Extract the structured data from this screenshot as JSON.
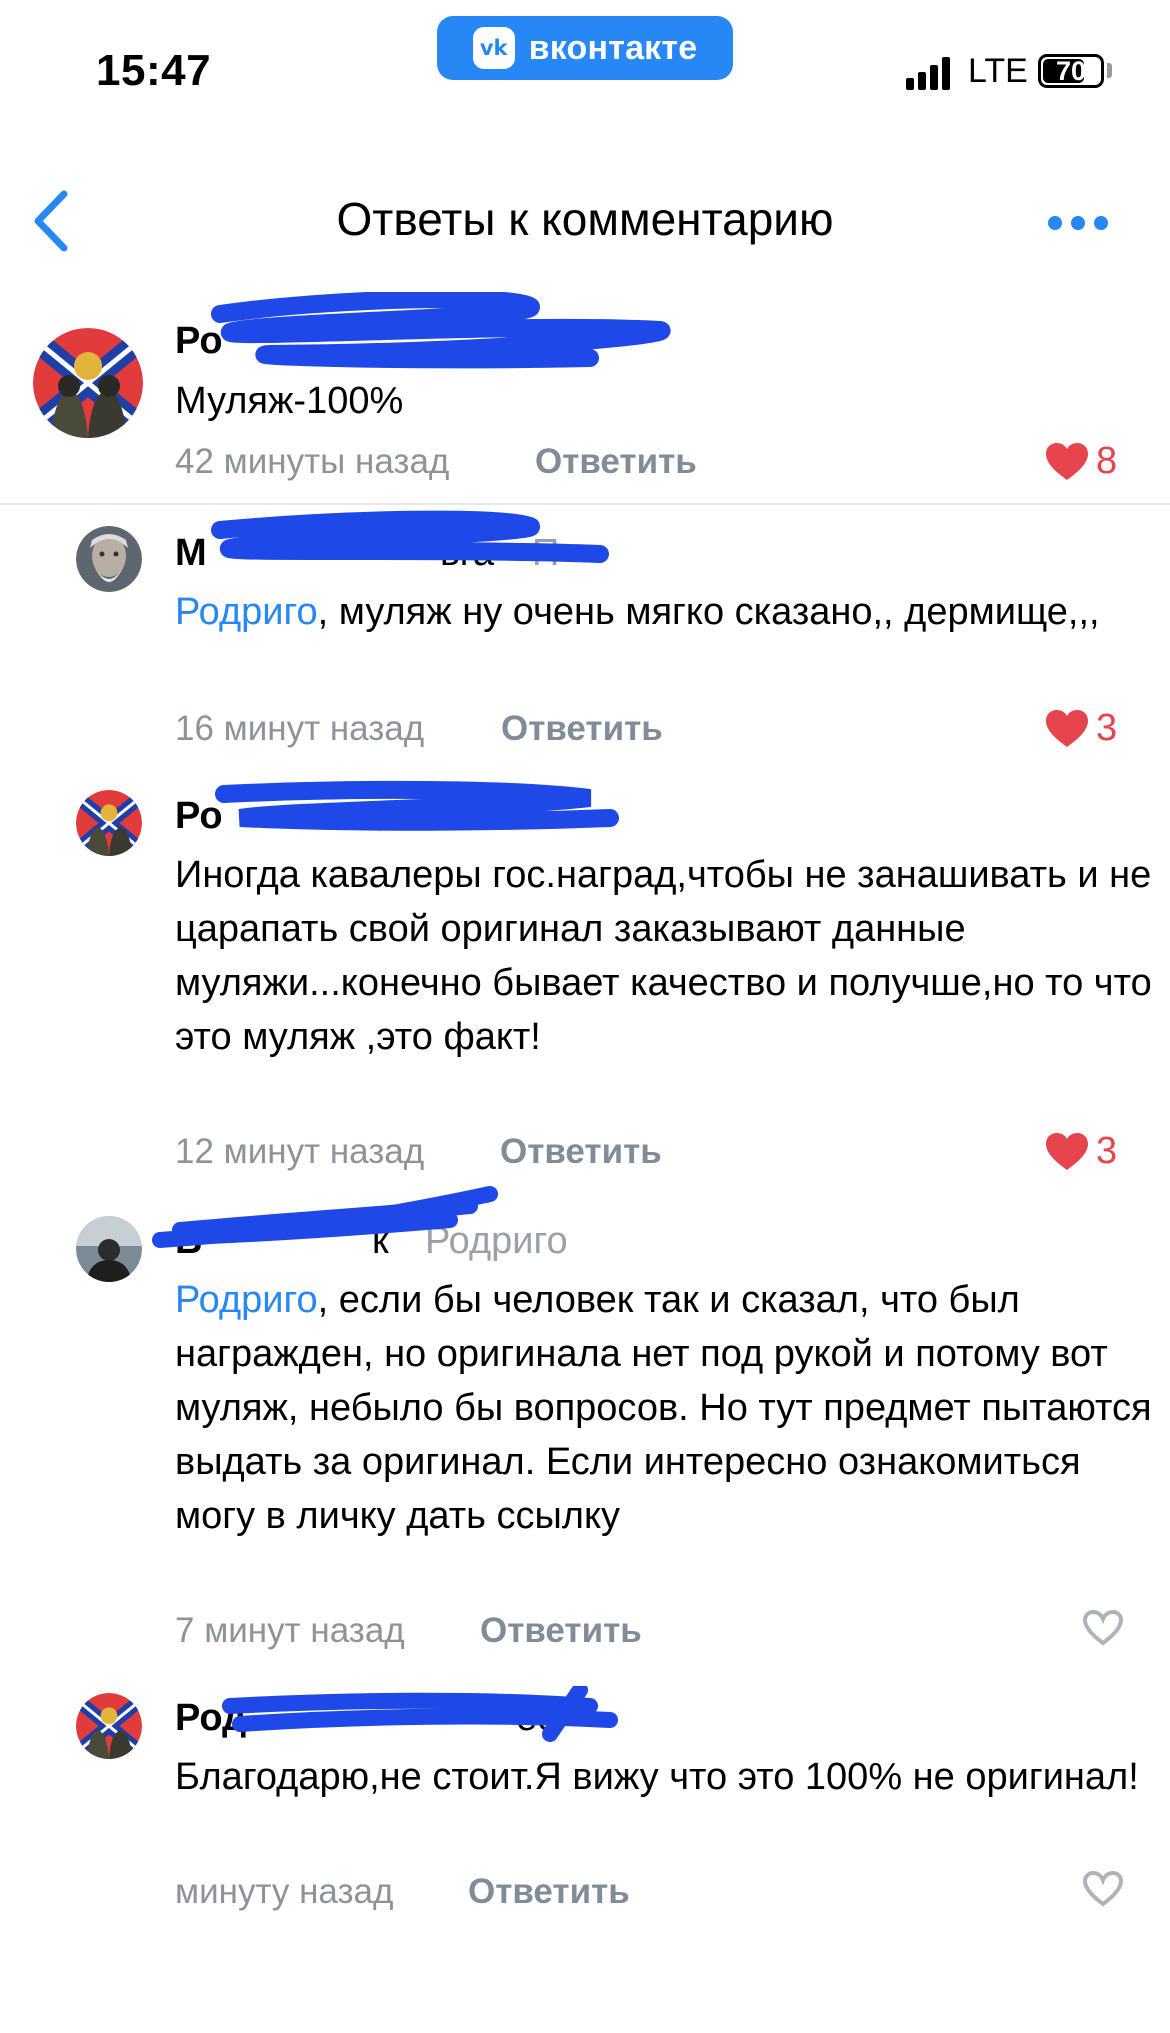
{
  "status_bar": {
    "time": "15:47",
    "network": "LTE",
    "battery": "70"
  },
  "vk_badge": {
    "logo_text": "vk",
    "label": "вконтакте"
  },
  "header": {
    "title": "Ответы к комментарию"
  },
  "comments": [
    {
      "name": "Ро",
      "text": "Муляж-100%",
      "time": "42 минуты назад",
      "reply": "Ответить",
      "likes": "8",
      "liked": true
    },
    {
      "name": "М",
      "name_suffix": "ьга",
      "name_tail": "П",
      "mention": "Родриго",
      "text": ", муляж ну очень мягко сказано,, дермище,,,",
      "time": "16 минут назад",
      "reply": "Ответить",
      "likes": "3",
      "liked": true
    },
    {
      "name": "Ро",
      "text": "Иногда кавалеры гос.наград,чтобы не занашивать и не царапать свой оригинал заказывают данные муляжи...конечно бывает качество и получше,но то что это муляж ,это факт!",
      "time": "12 минут назад",
      "reply": "Ответить",
      "likes": "3",
      "liked": true
    },
    {
      "name": "В",
      "name_suffix": "к",
      "reply_to": "Родриго",
      "mention": "Родриго",
      "text": ", если бы человек так и сказал, что был награжден, но оригинала нет под рукой и потому вот муляж, небыло бы вопросов. Но тут предмет пытаются выдать за оригинал. Если интересно ознакомиться могу в личку дать ссылку",
      "time": "7 минут назад",
      "reply": "Ответить",
      "likes": "",
      "liked": false
    },
    {
      "name": "Род",
      "name_suffix": "ес",
      "text": "Благодарю,не стоит.Я вижу что это 100% не оригинал!",
      "time": "минуту назад",
      "reply": "Ответить",
      "likes": "",
      "liked": false
    }
  ],
  "colors": {
    "accent": "#2787F5",
    "like": "#E6454E",
    "meta": "#8D9399",
    "scribble": "#1E49E8"
  }
}
